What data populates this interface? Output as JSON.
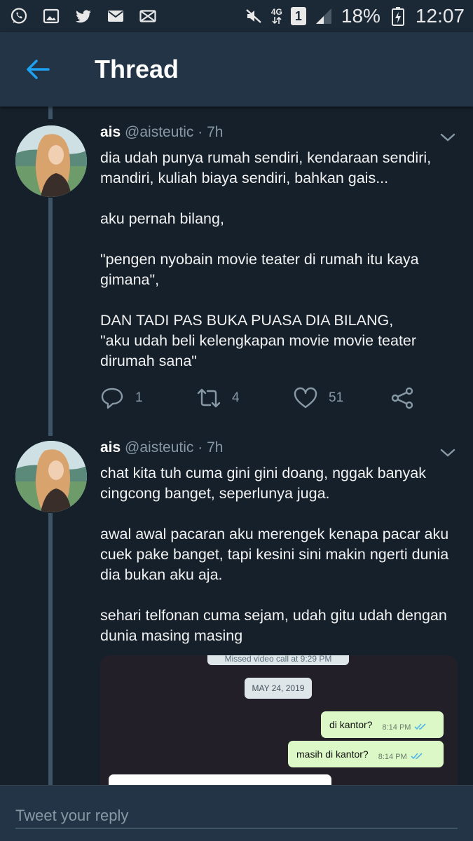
{
  "status_bar": {
    "network": "4G",
    "sim": "1",
    "battery": "18%",
    "time": "12:07"
  },
  "header": {
    "title": "Thread"
  },
  "tweets": [
    {
      "name": "ais",
      "handle": "@aisteutic",
      "separator": "·",
      "age": "7h",
      "paragraphs": [
        "dia udah punya rumah sendiri, kendaraan sendiri, mandiri, kuliah biaya sendiri, bahkan gais...",
        "aku pernah bilang,",
        "\"pengen nyobain movie teater di rumah itu kaya gimana\",",
        "DAN TADI PAS BUKA PUASA DIA BILANG,\n\"aku udah beli kelengkapan movie movie teater dirumah sana\""
      ],
      "replies": "1",
      "retweets": "4",
      "likes": "51"
    },
    {
      "name": "ais",
      "handle": "@aisteutic",
      "separator": "·",
      "age": "7h",
      "paragraphs": [
        "chat kita tuh cuma gini gini doang, nggak banyak cingcong banget, seperlunya juga.",
        "awal awal pacaran aku merengek kenapa pacar aku cuek pake banget, tapi kesini sini makin ngerti dunia dia bukan aku aja.",
        "sehari telfonan cuma sejam, udah gitu udah dengan dunia masing masing"
      ]
    }
  ],
  "attachment": {
    "missed_call": "Missed video call at 9:29 PM",
    "date": "MAY 24, 2019",
    "messages": [
      {
        "text": "di kantor?",
        "time": "8:14 PM"
      },
      {
        "text": "masih di kantor?",
        "time": "8:14 PM"
      }
    ]
  },
  "reply": {
    "placeholder": "Tweet your reply"
  },
  "colors": {
    "background": "#15202b",
    "header": "#243447",
    "accent": "#1da1f2",
    "muted": "#8899a6"
  }
}
